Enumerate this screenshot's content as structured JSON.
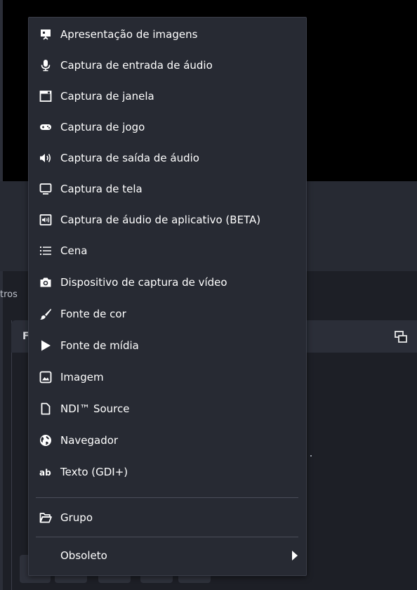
{
  "background": {
    "filter_label_fragment": "tros",
    "sources_dock_title_fragment": "F"
  },
  "menu": {
    "items": [
      {
        "label": "Apresentação de imagens",
        "icon": "slideshow-icon"
      },
      {
        "label": "Captura de entrada de áudio",
        "icon": "microphone-icon"
      },
      {
        "label": "Captura de janela",
        "icon": "window-icon"
      },
      {
        "label": "Captura de jogo",
        "icon": "gamepad-icon"
      },
      {
        "label": "Captura de saída de áudio",
        "icon": "speaker-icon"
      },
      {
        "label": "Captura de tela",
        "icon": "monitor-icon"
      },
      {
        "label": "Captura de áudio de aplicativo (BETA)",
        "icon": "app-audio-icon"
      },
      {
        "label": "Cena",
        "icon": "list-icon"
      },
      {
        "label": "Dispositivo de captura de vídeo",
        "icon": "camera-icon"
      },
      {
        "label": "Fonte de cor",
        "icon": "paintbrush-icon"
      },
      {
        "label": "Fonte de mídia",
        "icon": "play-icon"
      },
      {
        "label": "Imagem",
        "icon": "image-icon"
      },
      {
        "label": "NDI™ Source",
        "icon": "file-icon"
      },
      {
        "label": "Navegador",
        "icon": "globe-icon"
      },
      {
        "label": "Texto (GDI+)",
        "icon": "text-icon"
      }
    ],
    "group": {
      "label": "Grupo",
      "icon": "folder-icon"
    },
    "deprecated": {
      "label": "Obsoleto",
      "icon": "submenu-arrow-icon"
    }
  },
  "colors": {
    "menu_background": "#272a33",
    "app_background": "#1d1f26",
    "preview_background": "#000000",
    "text": "#ffffff"
  }
}
